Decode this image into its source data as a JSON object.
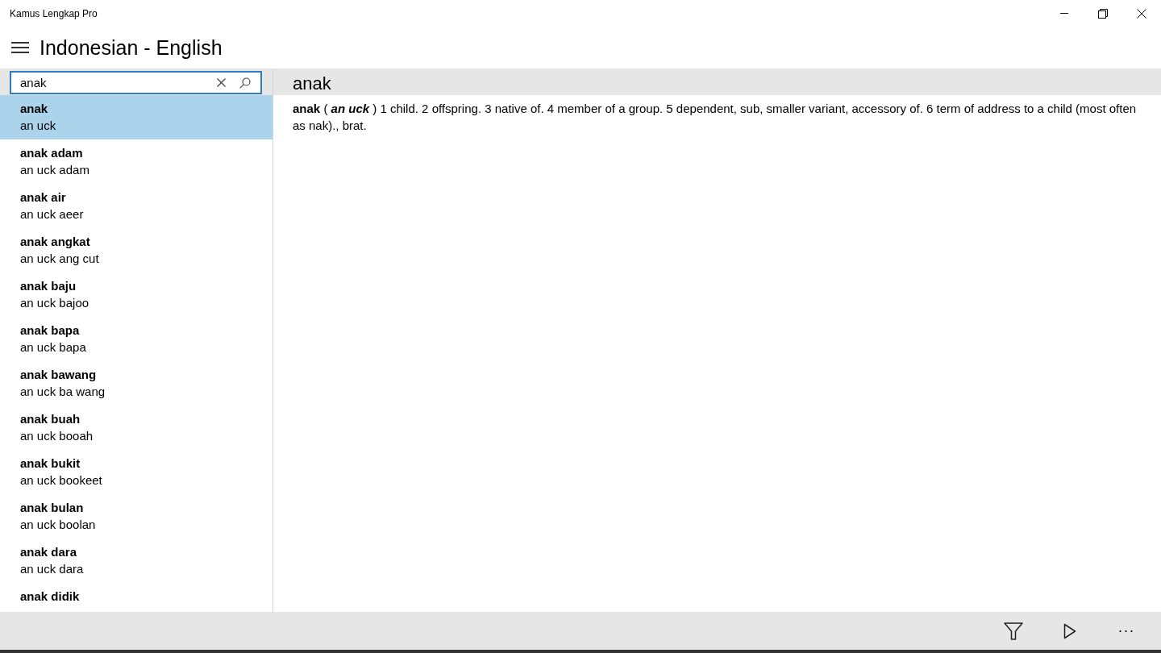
{
  "window": {
    "title": "Kamus Lengkap Pro"
  },
  "header": {
    "title": "Indonesian - English"
  },
  "search": {
    "value": "anak"
  },
  "results": [
    {
      "word": "anak",
      "pronunciation": "an uck",
      "selected": true
    },
    {
      "word": "anak adam",
      "pronunciation": "an uck adam",
      "selected": false
    },
    {
      "word": "anak air",
      "pronunciation": "an uck aeer",
      "selected": false
    },
    {
      "word": "anak angkat",
      "pronunciation": "an uck ang cut",
      "selected": false
    },
    {
      "word": "anak baju",
      "pronunciation": "an uck bajoo",
      "selected": false
    },
    {
      "word": "anak bapa",
      "pronunciation": "an uck bapa",
      "selected": false
    },
    {
      "word": "anak bawang",
      "pronunciation": "an uck ba wang",
      "selected": false
    },
    {
      "word": "anak buah",
      "pronunciation": "an uck booah",
      "selected": false
    },
    {
      "word": "anak bukit",
      "pronunciation": "an uck bookeet",
      "selected": false
    },
    {
      "word": "anak bulan",
      "pronunciation": "an uck boolan",
      "selected": false
    },
    {
      "word": "anak dara",
      "pronunciation": "an uck dara",
      "selected": false
    },
    {
      "word": "anak didik",
      "selected": false
    }
  ],
  "entry": {
    "title": "anak",
    "definition": [
      {
        "text": "anak",
        "kind": "headword"
      },
      {
        "text": "(",
        "kind": "plain"
      },
      {
        "text": "an uck",
        "kind": "pronunciation"
      },
      {
        "text": ")",
        "kind": "plain"
      },
      {
        "text": "1 child. 2 offspring. 3 native of. 4 member of a group. 5 dependent, sub, smaller variant, accessory of. 6 term of address to a child (most often as nak)., brat.",
        "kind": "plain"
      }
    ]
  },
  "command_bar": {
    "more": "···"
  }
}
